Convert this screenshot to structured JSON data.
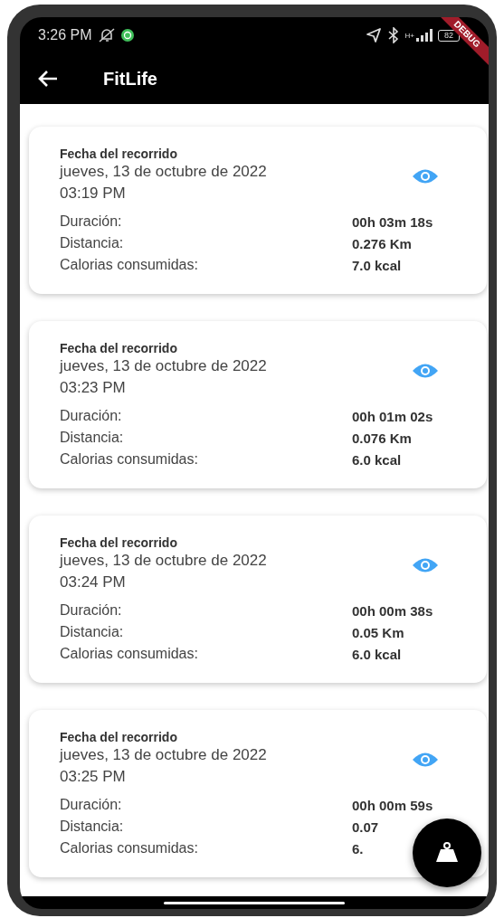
{
  "status_bar": {
    "time": "3:26 PM",
    "network": "H+",
    "battery": "82"
  },
  "debug_banner": "DEBUG",
  "app_bar": {
    "title": "FitLife"
  },
  "records": [
    {
      "title": "Fecha del recorrido",
      "date": "jueves, 13 de octubre de 2022",
      "time": "03:19 PM",
      "stats": [
        {
          "label": "Duración:",
          "value": "00h 03m 18s"
        },
        {
          "label": "Distancia:",
          "value": "0.276 Km"
        },
        {
          "label": "Calorias consumidas:",
          "value": "7.0 kcal"
        }
      ]
    },
    {
      "title": "Fecha del recorrido",
      "date": "jueves, 13 de octubre de 2022",
      "time": "03:23 PM",
      "stats": [
        {
          "label": "Duración:",
          "value": "00h 01m 02s"
        },
        {
          "label": "Distancia:",
          "value": "0.076 Km"
        },
        {
          "label": "Calorias consumidas:",
          "value": "6.0 kcal"
        }
      ]
    },
    {
      "title": "Fecha del recorrido",
      "date": "jueves, 13 de octubre de 2022",
      "time": "03:24 PM",
      "stats": [
        {
          "label": "Duración:",
          "value": "00h 00m 38s"
        },
        {
          "label": "Distancia:",
          "value": "0.05 Km"
        },
        {
          "label": "Calorias consumidas:",
          "value": "6.0 kcal"
        }
      ]
    },
    {
      "title": "Fecha del recorrido",
      "date": "jueves, 13 de octubre de 2022",
      "time": "03:25 PM",
      "stats": [
        {
          "label": "Duración:",
          "value": "00h 00m 59s"
        },
        {
          "label": "Distancia:",
          "value": "0.07"
        },
        {
          "label": "Calorias consumidas:",
          "value": "6."
        }
      ]
    }
  ]
}
